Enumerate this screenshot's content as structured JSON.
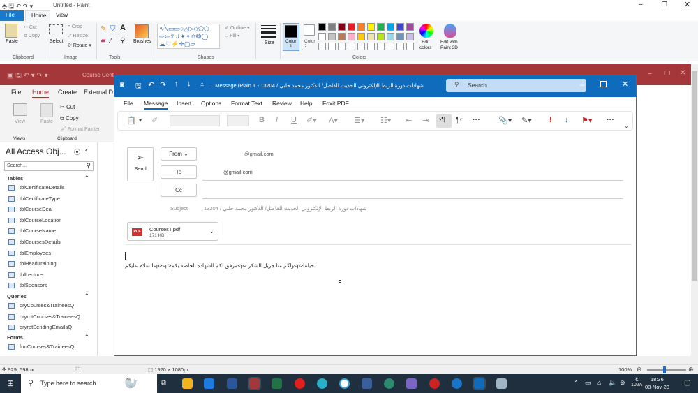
{
  "paint": {
    "title": "Untitled - Paint",
    "tabs": [
      "File",
      "Home",
      "View"
    ],
    "clipboard": {
      "paste": "Paste",
      "cut": "Cut",
      "copy": "Copy",
      "group": "Clipboard"
    },
    "image": {
      "select": "Select",
      "crop": "Crop",
      "resize": "Resize",
      "rotate": "Rotate",
      "group": "Image"
    },
    "tools_group": "Tools",
    "brushes": "Brushes",
    "shapes": {
      "outline": "Outline",
      "fill": "Fill",
      "group": "Shapes"
    },
    "size": "Size",
    "color1": "Color\n1",
    "color2": "Color\n2",
    "colors_group": "Colors",
    "edit_colors": "Edit\ncolors",
    "edit_paint3d": "Edit with\nPaint 3D",
    "palette": [
      "#000000",
      "#7f7f7f",
      "#880015",
      "#ed1c24",
      "#ff7f27",
      "#fff200",
      "#22b14c",
      "#00a2e8",
      "#3f48cc",
      "#a349a4",
      "#ffffff",
      "#c3c3c3",
      "#b97a57",
      "#ffaec9",
      "#ffc90e",
      "#efe4b0",
      "#b5e61d",
      "#99d9ea",
      "#7092be",
      "#c8bfe7"
    ]
  },
  "access": {
    "title_fragment": "Course Cent",
    "tabs": [
      "File",
      "Home",
      "Create",
      "External D"
    ],
    "cut": "Cut",
    "copy": "Copy",
    "format_painter": "Format Painter",
    "view": "View",
    "paste": "Paste",
    "views_group": "Views",
    "clipboard_group": "Clipboard",
    "nav_title": "All Access Obj...",
    "search_placeholder": "Search...",
    "tables_header": "Tables",
    "tables": [
      "tblCertificateDetails",
      "tblCertificateType",
      "tblCourseDeal",
      "tblCourseLocation",
      "tblCourseName",
      "tblCoursesDetails",
      "tblEmployees",
      "tblHeadTraining",
      "tblLecturer",
      "tblSponsors"
    ],
    "queries_header": "Queries",
    "queries": [
      "qryCourses&TraineesQ",
      "qryrptCourses&TraineesQ",
      "qryrptSendingEmailsQ"
    ],
    "forms_header": "Forms",
    "forms": [
      "frmCourses&TraineesQ"
    ]
  },
  "outlook": {
    "title": "شهادات دورة الربط الإلكتروني الحديث للفاصل/ الدكتور محمد حلبي / 13204 - Message (Plain T...",
    "search_placeholder": "Search",
    "menu": [
      "File",
      "Message",
      "Insert",
      "Options",
      "Format Text",
      "Review",
      "Help",
      "Foxit PDF"
    ],
    "send": "Send",
    "from_label": "From",
    "from_value": "@gmail.com",
    "to_label": "To",
    "to_value": "@gmail.com",
    "cc_label": "Cc",
    "subject_label": "Subject",
    "subject_value": "شهادات دورة الربط الإلكتروني الحديث للفاصل/ الدكتور محمد حلبي / 13204",
    "attachment_name": "CoursesT.pdf",
    "attachment_size": "171 KB",
    "attachment_type": "PDF",
    "body": "تحياتنا<p>ولكم منا جزيل الشكر <p>مرفق لكم الشهادة الخاصة بكم<p><p>السلام عليكم"
  },
  "status": {
    "cursor_pos": "929, 598px",
    "canvas_size": "1920 × 1080px",
    "zoom": "100%"
  },
  "taskbar": {
    "search_placeholder": "Type here to search",
    "time": "18:36",
    "date": "08-Nov-23",
    "lang": "ع",
    "kbd": "ENG",
    "lang_code": "102A"
  }
}
